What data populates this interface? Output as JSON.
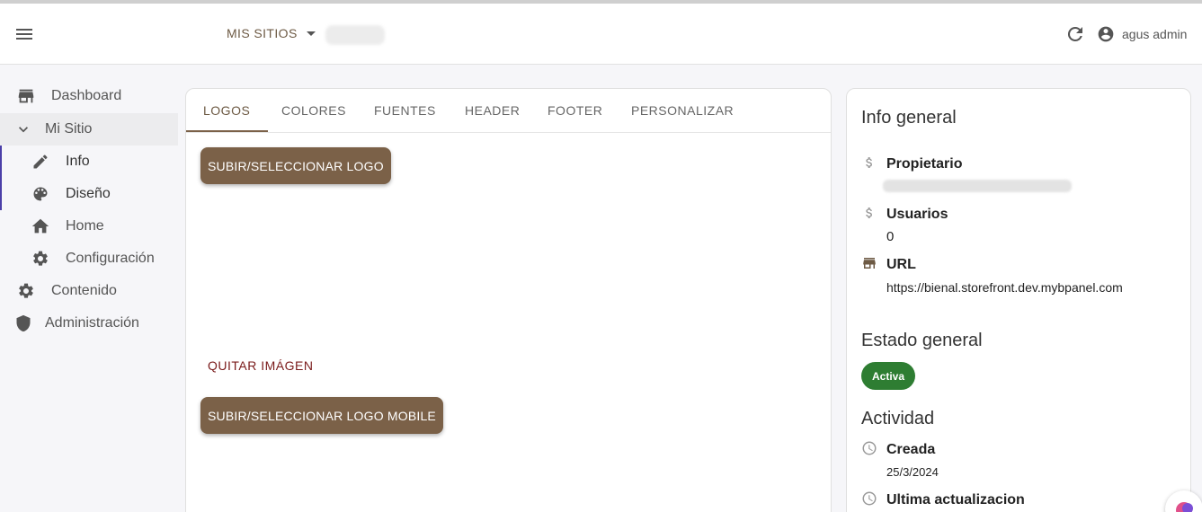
{
  "topbar": {
    "sites_label": "MIS SITIOS",
    "user_name": "agus admin"
  },
  "sidebar": {
    "items": [
      {
        "label": "Dashboard",
        "icon": "store-icon"
      },
      {
        "label": "Mi Sitio",
        "icon": "chevron-down-icon"
      },
      {
        "label": "Info",
        "icon": "pencil-icon"
      },
      {
        "label": "Diseño",
        "icon": "palette-icon"
      },
      {
        "label": "Home",
        "icon": "home-icon"
      },
      {
        "label": "Configuración",
        "icon": "gear-icon"
      },
      {
        "label": "Contenido",
        "icon": "gear-icon"
      },
      {
        "label": "Administración",
        "icon": "shield-icon"
      }
    ]
  },
  "main": {
    "tabs": [
      "LOGOS",
      "COLORES",
      "FUENTES",
      "HEADER",
      "FOOTER",
      "PERSONALIZAR"
    ],
    "active_tab": "LOGOS",
    "upload_logo": "SUBIR/SELECCIONAR LOGO",
    "remove_image": "QUITAR IMÁGEN",
    "upload_logo_mobile": "SUBIR/SELECCIONAR LOGO MOBILE"
  },
  "info": {
    "title": "Info general",
    "owner_label": "Propietario",
    "users_label": "Usuarios",
    "users_value": "0",
    "url_label": "URL",
    "url_value": "https://bienal.storefront.dev.mybpanel.com",
    "status_title": "Estado general",
    "status_badge": "Activa",
    "activity_title": "Actividad",
    "created_label": "Creada",
    "created_value": "25/3/2024",
    "updated_label": "Ultima actualizacion"
  },
  "colors": {
    "brand_brown": "#7b6148",
    "status_green": "#2e7d32",
    "accent_purple": "#4b3fa8"
  }
}
